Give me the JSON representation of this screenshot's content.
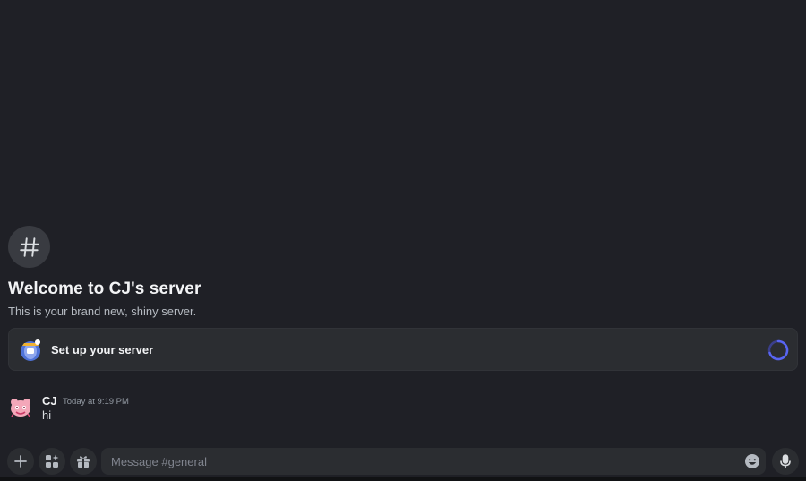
{
  "welcome": {
    "icon": "hashtag-icon",
    "title": "Welcome to CJ's server",
    "subtitle": "This is your brand new, shiny server."
  },
  "setup_card": {
    "icon": "server-setup-illustration-icon",
    "label": "Set up your server",
    "status_icon": "loading-spinner-icon"
  },
  "messages": [
    {
      "author": "CJ",
      "timestamp": "Today at 9:19 PM",
      "text": "hi",
      "avatar_icon": "pink-character-avatar"
    }
  ],
  "composer": {
    "placeholder": "Message #general",
    "buttons": [
      "plus-icon",
      "apps-icon",
      "gift-icon"
    ],
    "emoji_icon": "emoji-icon",
    "voice_icon": "microphone-icon"
  },
  "colors": {
    "background": "#1f2026",
    "card": "#2b2d31",
    "accent": "#5865f2",
    "text_primary": "#f2f3f5",
    "text_muted": "#b5bac1"
  }
}
